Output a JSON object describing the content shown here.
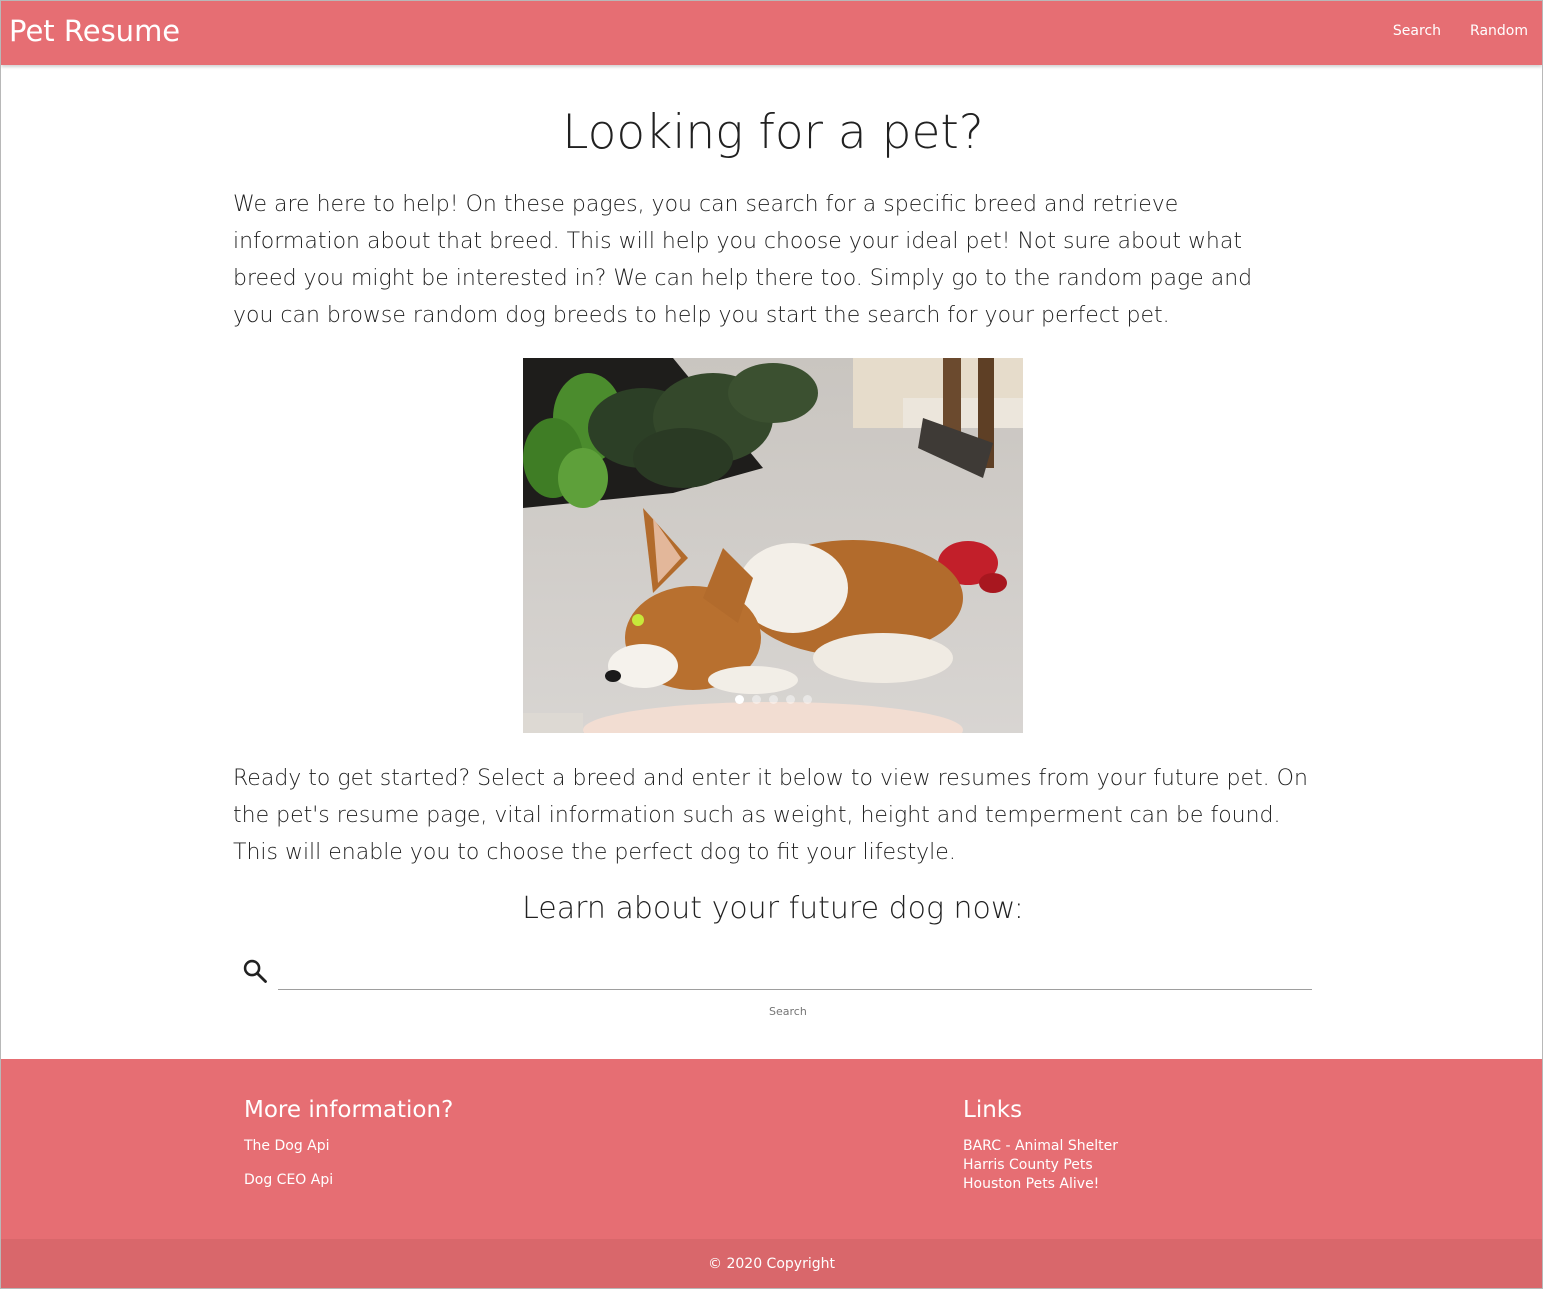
{
  "navbar": {
    "brand": "Pet Resume",
    "links": [
      "Search",
      "Random"
    ]
  },
  "main": {
    "title": "Looking for a pet?",
    "intro": "We are here to help! On these pages, you can search for a specific breed and retrieve information about that breed. This will help you choose your ideal pet! Not sure about what breed you might be interested in? We can help there too. Simply go to the random page and you can browse random dog breeds to help you start the search for your perfect pet.",
    "carousel": {
      "slide_count": 5,
      "active_index": 0
    },
    "cta": "Ready to get started? Select a breed and enter it below to view resumes from your future pet. On the pet's resume page, vital information such as weight, height and temperment can be found. This will enable you to choose the perfect dog to fit your lifestyle.",
    "learn_heading": "Learn about your future dog now:",
    "search": {
      "placeholder": "",
      "value": "",
      "button_label": "Search",
      "icon": "search-icon"
    }
  },
  "footer": {
    "left_heading": "More information?",
    "left_links": [
      "The Dog Api",
      "Dog CEO Api"
    ],
    "right_heading": "Links",
    "right_links": [
      "BARC - Animal Shelter",
      "Harris County Pets",
      "Houston Pets Alive!"
    ],
    "copyright": "© 2020 Copyright"
  },
  "colors": {
    "brand": "#e66e73",
    "copyright_bar": "#d9676b"
  }
}
